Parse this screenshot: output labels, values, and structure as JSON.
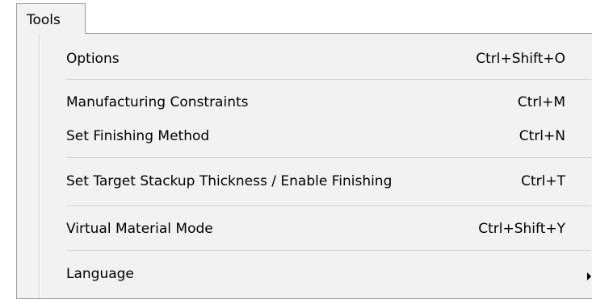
{
  "menubar": {
    "title": "Tools"
  },
  "menu": {
    "items": [
      {
        "label": "Options",
        "shortcut": "Ctrl+Shift+O"
      },
      {
        "label": "Manufacturing Constraints",
        "shortcut": "Ctrl+M"
      },
      {
        "label": "Set Finishing Method",
        "shortcut": "Ctrl+N"
      },
      {
        "label": "Set Target Stackup Thickness / Enable Finishing",
        "shortcut": "Ctrl+T"
      },
      {
        "label": "Virtual Material Mode",
        "shortcut": "Ctrl+Shift+Y"
      },
      {
        "label": "Language",
        "shortcut": "",
        "submenu_icon": "submenu-arrow-icon"
      }
    ]
  },
  "colors": {
    "menu_background": "#f2f2f2",
    "border": "#a0a0a0",
    "separator": "#d0d0d0",
    "text": "#000000"
  }
}
